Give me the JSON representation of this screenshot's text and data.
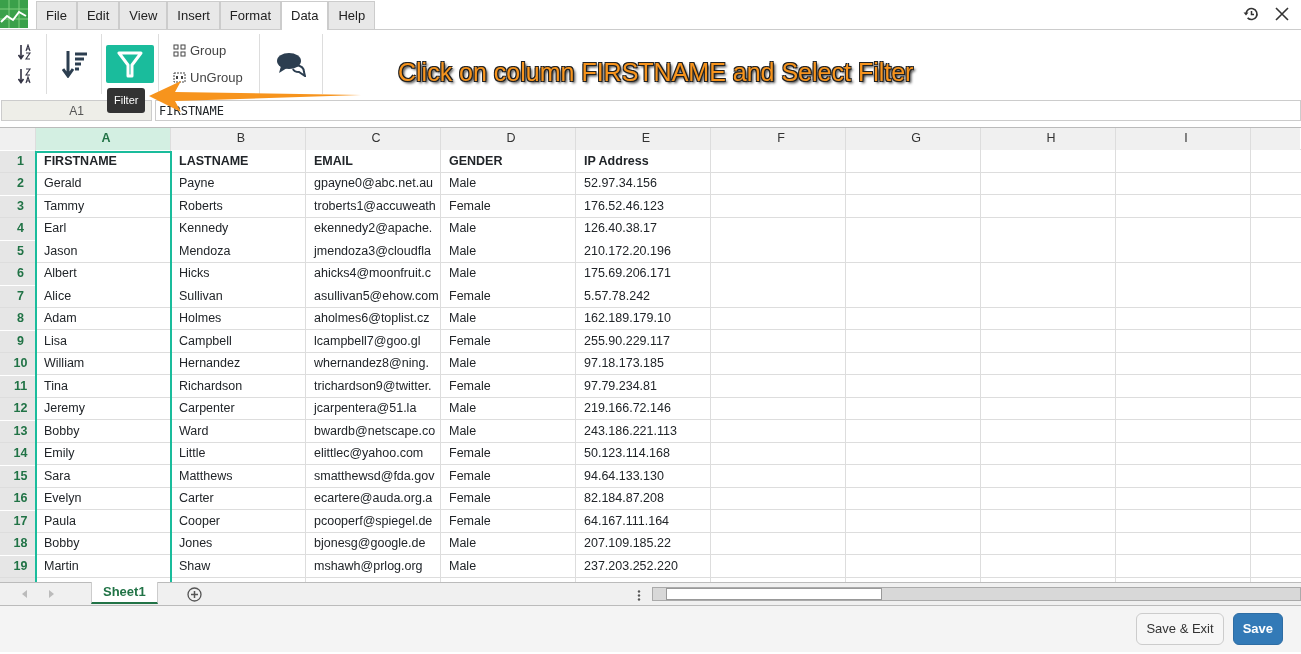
{
  "menu_tabs": [
    {
      "label": "File",
      "selected": false
    },
    {
      "label": "Edit",
      "selected": false
    },
    {
      "label": "View",
      "selected": false
    },
    {
      "label": "Insert",
      "selected": false
    },
    {
      "label": "Format",
      "selected": false
    },
    {
      "label": "Data",
      "selected": true
    },
    {
      "label": "Help",
      "selected": false
    }
  ],
  "ribbon": {
    "group_label": "Group",
    "ungroup_label": "UnGroup",
    "tooltip": "Filter"
  },
  "annotation": "Click on column FIRSTNAME and Select Filter",
  "name_box": "A1",
  "formula": "FIRSTNAME",
  "columns": [
    {
      "label": "A",
      "selected": true
    },
    {
      "label": "B",
      "selected": false
    },
    {
      "label": "C",
      "selected": false
    },
    {
      "label": "D",
      "selected": false
    },
    {
      "label": "E",
      "selected": false
    },
    {
      "label": "F",
      "selected": false
    },
    {
      "label": "G",
      "selected": false
    },
    {
      "label": "H",
      "selected": false
    },
    {
      "label": "I",
      "selected": false
    }
  ],
  "rows": [
    {
      "number": "1",
      "header": true,
      "cells": [
        "FIRSTNAME",
        "LASTNAME",
        "EMAIL",
        "GENDER",
        "IP Address"
      ]
    },
    {
      "number": "2",
      "header": false,
      "cells": [
        "Gerald",
        "Payne",
        "gpayne0@abc.net.au",
        "Male",
        "52.97.34.156"
      ]
    },
    {
      "number": "3",
      "header": false,
      "cells": [
        "Tammy",
        "Roberts",
        "troberts1@accuweath",
        "Female",
        "176.52.46.123"
      ]
    },
    {
      "number": "4",
      "header": false,
      "cells": [
        "Earl",
        "Kennedy",
        "ekennedy2@apache.",
        "Male",
        "126.40.38.17"
      ]
    },
    {
      "number": "5",
      "header": false,
      "cells": [
        "Jason",
        "Mendoza",
        "jmendoza3@cloudfla",
        "Male",
        "210.172.20.196"
      ]
    },
    {
      "number": "6",
      "header": false,
      "cells": [
        "Albert",
        "Hicks",
        "ahicks4@moonfruit.c",
        "Male",
        "175.69.206.171"
      ]
    },
    {
      "number": "7",
      "header": false,
      "cells": [
        "Alice",
        "Sullivan",
        "asullivan5@ehow.com",
        "Female",
        "5.57.78.242"
      ]
    },
    {
      "number": "8",
      "header": false,
      "cells": [
        "Adam",
        "Holmes",
        "aholmes6@toplist.cz",
        "Male",
        "162.189.179.10"
      ]
    },
    {
      "number": "9",
      "header": false,
      "cells": [
        "Lisa",
        "Campbell",
        "lcampbell7@goo.gl",
        "Female",
        "255.90.229.117"
      ]
    },
    {
      "number": "10",
      "header": false,
      "cells": [
        "William",
        "Hernandez",
        "whernandez8@ning.",
        "Male",
        "97.18.173.185"
      ]
    },
    {
      "number": "11",
      "header": false,
      "cells": [
        "Tina",
        "Richardson",
        "trichardson9@twitter.",
        "Female",
        "97.79.234.81"
      ]
    },
    {
      "number": "12",
      "header": false,
      "cells": [
        "Jeremy",
        "Carpenter",
        "jcarpentera@51.la",
        "Male",
        "219.166.72.146"
      ]
    },
    {
      "number": "13",
      "header": false,
      "cells": [
        "Bobby",
        "Ward",
        "bwardb@netscape.co",
        "Male",
        "243.186.221.113"
      ]
    },
    {
      "number": "14",
      "header": false,
      "cells": [
        "Emily",
        "Little",
        "elittlec@yahoo.com",
        "Female",
        "50.123.114.168"
      ]
    },
    {
      "number": "15",
      "header": false,
      "cells": [
        "Sara",
        "Matthews",
        "smatthewsd@fda.gov",
        "Female",
        "94.64.133.130"
      ]
    },
    {
      "number": "16",
      "header": false,
      "cells": [
        "Evelyn",
        "Carter",
        "ecartere@auda.org.a",
        "Female",
        "82.184.87.208"
      ]
    },
    {
      "number": "17",
      "header": false,
      "cells": [
        "Paula",
        "Cooper",
        "pcooperf@spiegel.de",
        "Female",
        "64.167.111.164"
      ]
    },
    {
      "number": "18",
      "header": false,
      "cells": [
        "Bobby",
        "Jones",
        "bjonesg@google.de",
        "Male",
        "207.109.185.22"
      ]
    },
    {
      "number": "19",
      "header": false,
      "cells": [
        "Martin",
        "Shaw",
        "mshawh@prlog.org",
        "Male",
        "237.203.252.220"
      ]
    }
  ],
  "sheet_tabs": [
    {
      "label": "Sheet1",
      "selected": true
    }
  ],
  "buttons": [
    {
      "label": "Save & Exit",
      "kind": "secondary"
    },
    {
      "label": "Save",
      "kind": "primary"
    }
  ]
}
